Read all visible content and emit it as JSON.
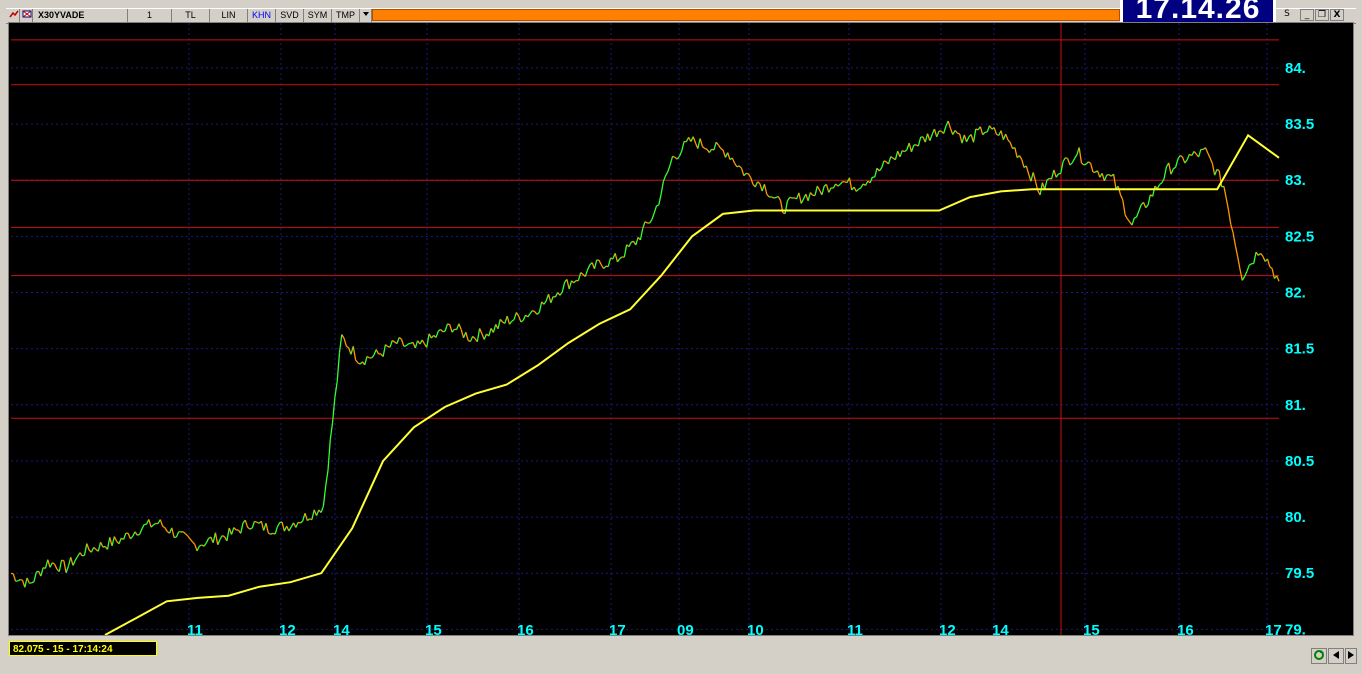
{
  "toolbar": {
    "symbol": "X30YVADE",
    "period": "1",
    "currency": "TL",
    "scale": "LIN",
    "khn": "KHN",
    "svd": "SVD",
    "sym": "SYM",
    "tmp": "TMP",
    "dropdown_icon": "chevron-down-icon"
  },
  "clock": "17.14.26",
  "window_buttons": {
    "settings_label": "S",
    "minimize_label": "_",
    "restore_label": "❐",
    "close_label": "X"
  },
  "status": "82.075 - 15 - 17:14:24",
  "colors": {
    "background": "#000000",
    "price_up": "#33ff33",
    "price_down": "#ff9900",
    "moving_average": "#ffff33",
    "level_lines": "#cc1111",
    "axis_text": "#00ffff",
    "grid": "#1a1a80"
  },
  "chart_data": {
    "type": "line",
    "symbol": "X30YVADE",
    "y_ticks": [
      "84.",
      "83.5",
      "83.",
      "82.5",
      "82.",
      "81.5",
      "81.",
      "80.5",
      "80.",
      "79.5",
      "79."
    ],
    "y_tick_values": [
      84,
      83.5,
      83,
      82.5,
      82,
      81.5,
      81,
      80.5,
      80,
      79.5,
      79
    ],
    "ylim": [
      78.95,
      84.4
    ],
    "x_ticks": [
      "11",
      "12",
      "14",
      "15",
      "16",
      "17",
      "09",
      "10",
      "11",
      "12",
      "14",
      "15",
      "16",
      "17"
    ],
    "horizontal_levels": [
      84.25,
      83.85,
      83.0,
      82.58,
      82.15,
      80.88
    ],
    "cursor_line_x_label": "15",
    "series": [
      {
        "name": "",
        "kind": "price",
        "values": [
          79.5,
          79.4,
          79.6,
          79.55,
          79.7,
          79.75,
          79.8,
          79.9,
          79.95,
          79.85,
          79.75,
          79.8,
          79.85,
          79.95,
          79.9,
          79.92,
          80.0,
          80.1,
          81.6,
          81.4,
          81.45,
          81.55,
          81.5,
          81.6,
          81.7,
          81.6,
          81.65,
          81.75,
          81.8,
          81.9,
          82.05,
          82.15,
          82.25,
          82.3,
          82.45,
          82.7,
          83.2,
          83.35,
          83.3,
          83.25,
          83.05,
          82.95,
          82.75,
          82.85,
          82.9,
          83.0,
          82.95,
          83.05,
          83.2,
          83.3,
          83.4,
          83.5,
          83.35,
          83.45,
          83.4,
          83.2,
          82.9,
          83.1,
          83.25,
          83.1,
          83.0,
          82.6,
          82.85,
          83.1,
          83.2,
          83.25,
          82.95,
          82.15,
          82.4,
          82.1
        ]
      },
      {
        "name": "",
        "kind": "moving_average",
        "values": [
          78.9,
          79.1,
          79.25,
          79.28,
          79.3,
          79.38,
          79.42,
          79.5,
          79.9,
          80.5,
          80.8,
          80.98,
          81.1,
          81.18,
          81.35,
          81.55,
          81.72,
          81.85,
          82.15,
          82.5,
          82.7,
          82.73,
          82.73,
          82.73,
          82.73,
          82.73,
          82.73,
          82.73,
          82.85,
          82.9,
          82.92,
          82.92,
          82.92,
          82.92,
          82.92,
          82.92,
          82.92,
          83.4,
          83.2
        ]
      }
    ],
    "grid": true,
    "legend": "none"
  }
}
